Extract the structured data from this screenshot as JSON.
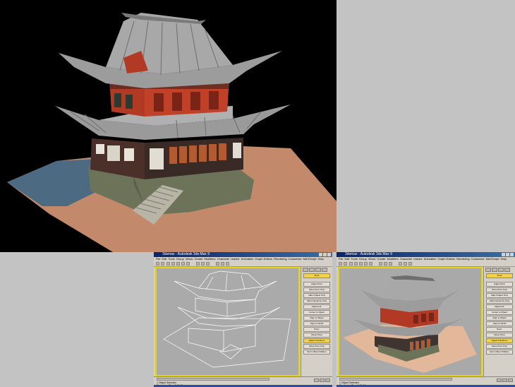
{
  "colors": {
    "background": "#c3c3c3",
    "render_background": "#000000",
    "viewport_border_active": "#e6d500",
    "ground_tan": "#c2896a",
    "ground_blue": "#4c6a82",
    "wall_red": "#b23a24",
    "roof_gray": "#9a9a9a",
    "stone_green": "#6c7358",
    "titlebar_blue": "#0a246a"
  },
  "screens": [
    {
      "id": "left-max-window",
      "title": "3dsmax - Autodesk 3ds Max 9",
      "menu": [
        "File",
        "Edit",
        "Tools",
        "Group",
        "Views",
        "Create",
        "Modifiers",
        "Character",
        "reactor",
        "Animation",
        "Graph Editors",
        "Rendering",
        "Customize",
        "MAXScript",
        "Help"
      ],
      "viewport_mode": "wireframe",
      "command_panel": {
        "buttons": [
          "Adjust Pivot",
          "Move Pivot Only",
          "Affect Object Only",
          "Affect Hierarchy Only",
          "Alignment:",
          "Center to Object",
          "Align to Object",
          "Align to World",
          "Pivot:",
          "Reset Pivot",
          "Adjust Transform",
          "Move Pivot Only",
          "Don't Affect Children"
        ]
      },
      "status": {
        "line1": "1 Object Selected",
        "line2": "Rendering Time 0:00:01"
      }
    },
    {
      "id": "right-max-window",
      "title": "3dsmax - Autodesk 3ds Max 9",
      "menu": [
        "File",
        "Edit",
        "Tools",
        "Group",
        "Views",
        "Create",
        "Modifiers",
        "Character",
        "reactor",
        "Animation",
        "Graph Editors",
        "Rendering",
        "Customize",
        "MAXScript",
        "Help"
      ],
      "viewport_mode": "smooth-highlights",
      "command_panel": {
        "buttons": [
          "Adjust Pivot",
          "Move Pivot Only",
          "Affect Object Only",
          "Affect Hierarchy Only",
          "Alignment:",
          "Center to Object",
          "Align to Object",
          "Align to World",
          "Pivot:",
          "Reset Pivot",
          "Adjust Transform",
          "Move Pivot Only",
          "Don't Affect Children"
        ]
      },
      "status": {
        "line1": "1 Object Selected",
        "line2": "Rendering Time 0:00:01"
      }
    }
  ]
}
